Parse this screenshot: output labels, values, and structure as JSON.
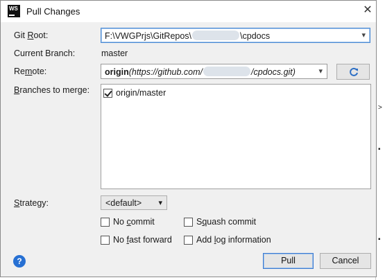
{
  "window": {
    "title": "Pull Changes",
    "app_icon": "WS"
  },
  "labels": {
    "git_root": "Git Root:",
    "current_branch": "Current Branch:",
    "remote": "Remote:",
    "branches": "Branches to merge:",
    "strategy": "Strategy:"
  },
  "git_root": {
    "prefix": "F:\\VWGPrjs\\GitRepos\\",
    "suffix": "\\cpdocs"
  },
  "current_branch": "master",
  "remote": {
    "name": "origin",
    "url_prefix": "(https://github.com/",
    "url_suffix": "/cpdocs.git)"
  },
  "branches": [
    {
      "label": "origin/master",
      "checked": true
    }
  ],
  "strategy": {
    "value": "<default>"
  },
  "options": {
    "no_commit": "No commit",
    "squash_commit": "Squash commit",
    "no_fast_forward": "No fast forward",
    "add_log": "Add log information"
  },
  "buttons": {
    "pull": "Pull",
    "cancel": "Cancel"
  },
  "colors": {
    "accent": "#3d7bd0",
    "help": "#2770d3",
    "dialog_bg": "#f0f0f0"
  },
  "icons": [
    "close-icon",
    "refresh-icon",
    "help-icon",
    "chevron-down-icon"
  ]
}
